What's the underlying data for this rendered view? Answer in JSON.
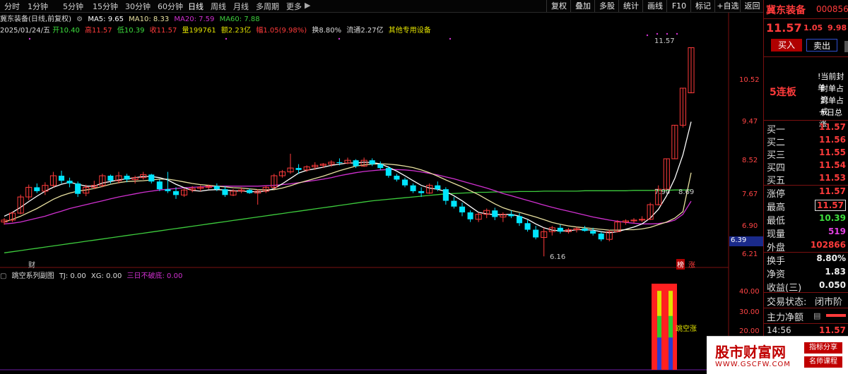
{
  "toolbar": {
    "periods": [
      "分时",
      "1分钟",
      "5分钟",
      "15分钟",
      "30分钟",
      "60分钟",
      "日线",
      "周线",
      "月线",
      "多周期",
      "更多"
    ],
    "active_period": "日线",
    "buttons": [
      "复权",
      "叠加",
      "多股",
      "统计",
      "画线",
      "F10",
      "标记",
      "+自选",
      "返回"
    ]
  },
  "info": {
    "stock_title": "冀东装备(日线,前复权)",
    "ma5": "MA5: 9.65",
    "ma10": "MA10: 8.33",
    "ma20": "MA20: 7.59",
    "ma60": "MA60: 7.88",
    "date": "2025/01/24/五",
    "open": "开10.40",
    "high": "高11.57",
    "low": "低10.39",
    "close": "收11.57",
    "volume": "量199761",
    "amount": "额2.23亿",
    "change": "幅1.05(9.98%)",
    "turnover": "换8.80%",
    "float": "流通2.27亿",
    "sector": "其他专用设备"
  },
  "price_axis": [
    "10.52",
    "9.47",
    "8.52",
    "7.67",
    "6.90",
    "6.21"
  ],
  "current_price_tag": "6.39",
  "annotations": {
    "high_label": "11.57",
    "low_label": "6.16",
    "ma_label": "7.90",
    "ma_label2": "8.69",
    "cai_marker": "财",
    "bang_marker": "榜",
    "zhang_marker": "涨"
  },
  "indicator": {
    "name": "跳空系列副图",
    "tj": "TJ: 0.00",
    "xg": "XG: 0.00",
    "rule": "三日不破底: 0.00",
    "axis": [
      "40.00",
      "30.00",
      "20.00"
    ],
    "tag": "跳空涨"
  },
  "quote": {
    "name": "冀东装备",
    "code": "000856",
    "price": "11.57",
    "change": "1.05",
    "pct": "9.98",
    "buy_label": "买入",
    "sell_label": "卖出",
    "limit_board": "5连板",
    "notes": [
      "!当前封单",
      "封单占流",
      "封单占成",
      "十日总涨"
    ],
    "book": [
      {
        "k": "买一",
        "v": "11.57"
      },
      {
        "k": "买二",
        "v": "11.56"
      },
      {
        "k": "买三",
        "v": "11.55"
      },
      {
        "k": "买四",
        "v": "11.54"
      },
      {
        "k": "买五",
        "v": "11.53"
      }
    ],
    "stats": [
      {
        "k": "涨停",
        "v": "11.57",
        "c": "#ff3b3b"
      },
      {
        "k": "最高",
        "v": "11.57",
        "c": "#ff3b3b"
      },
      {
        "k": "最低",
        "v": "10.39",
        "c": "#3dde3d"
      },
      {
        "k": "现量",
        "v": "519",
        "c": "#e040e0"
      },
      {
        "k": "外盘",
        "v": "102866",
        "c": "#ff3b3b"
      }
    ],
    "stats2": [
      {
        "k": "换手",
        "v": "8.80%",
        "c": "#eeeeee"
      },
      {
        "k": "净资",
        "v": "1.83",
        "c": "#eeeeee"
      },
      {
        "k": "收益(三)",
        "v": "0.050",
        "c": "#eeeeee"
      }
    ],
    "trade_status_label": "交易状态:",
    "trade_status": "闭市阶",
    "main_flow_label": "主力净额",
    "tick_time": "14:56",
    "tick_price": "11.57"
  },
  "watermark": {
    "site": "股市财富网",
    "url": "WWW.GSCFW.COM",
    "tag1": "指标分享",
    "tag2": "名师课程"
  },
  "colors": {
    "up": "#ff3b3b",
    "down": "#00e5ff",
    "ma5": "#ffffff",
    "ma10": "#e8e0a0",
    "ma20": "#d030d0",
    "ma60": "#3dcc3d"
  },
  "chart_data": {
    "type": "candlestick",
    "price_ylim": [
      6.0,
      11.8
    ],
    "candles": [
      [
        7.05,
        7.15,
        6.98,
        7.1
      ],
      [
        7.1,
        7.32,
        7.05,
        7.28
      ],
      [
        7.28,
        7.76,
        7.25,
        7.7
      ],
      [
        7.7,
        8.02,
        7.62,
        7.95
      ],
      [
        7.95,
        8.05,
        7.8,
        7.85
      ],
      [
        7.85,
        8.08,
        7.75,
        8.0
      ],
      [
        8.0,
        8.35,
        7.95,
        8.25
      ],
      [
        8.25,
        8.38,
        8.05,
        8.12
      ],
      [
        8.12,
        8.2,
        7.95,
        8.05
      ],
      [
        8.05,
        8.1,
        7.7,
        7.78
      ],
      [
        7.8,
        8.02,
        7.72,
        7.95
      ],
      [
        7.95,
        8.12,
        7.9,
        8.0
      ],
      [
        8.0,
        8.3,
        7.95,
        8.25
      ],
      [
        8.25,
        8.28,
        8.05,
        8.12
      ],
      [
        8.12,
        8.35,
        8.05,
        8.25
      ],
      [
        8.25,
        8.3,
        8.08,
        8.15
      ],
      [
        8.15,
        8.25,
        8.05,
        8.2
      ],
      [
        8.2,
        8.35,
        8.15,
        8.28
      ],
      [
        8.28,
        8.3,
        8.05,
        8.1
      ],
      [
        8.1,
        8.15,
        7.85,
        7.9
      ],
      [
        7.9,
        8.35,
        7.8,
        7.85
      ],
      [
        7.85,
        7.95,
        7.65,
        7.75
      ],
      [
        7.75,
        7.92,
        7.7,
        7.88
      ],
      [
        7.88,
        7.98,
        7.82,
        7.92
      ],
      [
        7.92,
        8.0,
        7.85,
        7.95
      ],
      [
        7.95,
        8.02,
        7.9,
        7.98
      ],
      [
        7.98,
        8.05,
        7.85,
        7.9
      ],
      [
        7.9,
        7.98,
        7.7,
        7.75
      ],
      [
        7.75,
        7.9,
        7.72,
        7.85
      ],
      [
        7.85,
        7.95,
        7.8,
        7.88
      ],
      [
        7.88,
        7.92,
        7.78,
        7.8
      ],
      [
        7.8,
        7.9,
        7.5,
        7.85
      ],
      [
        7.85,
        8.0,
        7.8,
        7.95
      ],
      [
        7.95,
        8.3,
        7.9,
        8.25
      ],
      [
        8.25,
        8.4,
        8.2,
        8.35
      ],
      [
        8.35,
        8.82,
        8.3,
        8.45
      ],
      [
        8.45,
        8.55,
        8.3,
        8.4
      ],
      [
        8.4,
        8.52,
        8.35,
        8.48
      ],
      [
        8.48,
        8.6,
        8.4,
        8.52
      ],
      [
        8.52,
        8.58,
        8.45,
        8.55
      ],
      [
        8.55,
        8.65,
        8.48,
        8.6
      ],
      [
        8.6,
        8.7,
        8.52,
        8.58
      ],
      [
        8.58,
        8.72,
        8.55,
        8.65
      ],
      [
        8.65,
        8.68,
        8.45,
        8.5
      ],
      [
        8.5,
        8.72,
        8.48,
        8.65
      ],
      [
        8.65,
        8.7,
        8.5,
        8.55
      ],
      [
        8.55,
        8.62,
        8.4,
        8.45
      ],
      [
        8.45,
        8.5,
        8.2,
        8.25
      ],
      [
        8.25,
        8.3,
        8.1,
        8.15
      ],
      [
        8.15,
        8.2,
        7.95,
        8.0
      ],
      [
        8.0,
        8.05,
        7.8,
        7.85
      ],
      [
        7.85,
        7.95,
        7.7,
        7.8
      ],
      [
        7.8,
        8.05,
        7.78,
        8.0
      ],
      [
        8.0,
        8.1,
        7.85,
        7.9
      ],
      [
        7.9,
        7.95,
        7.5,
        7.6
      ],
      [
        7.6,
        7.7,
        7.4,
        7.45
      ],
      [
        7.45,
        7.55,
        7.2,
        7.3
      ],
      [
        7.3,
        7.35,
        7.05,
        7.12
      ],
      [
        7.12,
        7.3,
        7.05,
        7.25
      ],
      [
        7.25,
        7.4,
        7.15,
        7.35
      ],
      [
        7.35,
        7.42,
        7.1,
        7.18
      ],
      [
        7.18,
        7.3,
        7.05,
        7.25
      ],
      [
        7.25,
        7.35,
        7.15,
        7.2
      ],
      [
        7.2,
        7.28,
        6.95,
        7.02
      ],
      [
        7.02,
        7.1,
        6.8,
        6.85
      ],
      [
        6.85,
        6.95,
        6.6,
        6.65
      ],
      [
        6.65,
        6.9,
        6.16,
        6.8
      ],
      [
        6.8,
        6.95,
        6.7,
        6.9
      ],
      [
        6.9,
        6.98,
        6.75,
        6.8
      ],
      [
        6.8,
        6.9,
        6.75,
        6.85
      ],
      [
        6.85,
        6.92,
        6.78,
        6.88
      ],
      [
        6.88,
        6.95,
        6.8,
        6.82
      ],
      [
        6.82,
        6.9,
        6.7,
        6.75
      ],
      [
        6.75,
        6.8,
        6.55,
        6.6
      ],
      [
        6.6,
        6.85,
        6.55,
        6.8
      ],
      [
        6.8,
        7.1,
        6.78,
        7.05
      ],
      [
        7.05,
        7.12,
        6.98,
        7.08
      ],
      [
        7.08,
        7.15,
        7.02,
        7.1
      ],
      [
        7.1,
        7.2,
        7.05,
        7.12
      ],
      [
        7.12,
        7.55,
        7.1,
        7.5
      ],
      [
        7.5,
        8.0,
        7.48,
        7.9
      ],
      [
        7.9,
        8.69,
        7.9,
        8.69
      ],
      [
        8.69,
        9.56,
        8.69,
        9.56
      ],
      [
        9.56,
        10.52,
        9.5,
        10.52
      ],
      [
        10.4,
        11.57,
        10.39,
        11.57
      ]
    ],
    "ma5": [
      7.2,
      7.3,
      7.43,
      7.58,
      7.72,
      7.85,
      7.95,
      8.03,
      8.08,
      8.03,
      7.98,
      7.98,
      8.06,
      8.1,
      8.14,
      8.17,
      8.2,
      8.23,
      8.23,
      8.2,
      8.14,
      8.03,
      7.94,
      7.87,
      7.85,
      7.88,
      7.89,
      7.88,
      7.86,
      7.85,
      7.84,
      7.83,
      7.85,
      7.92,
      8.04,
      8.18,
      8.32,
      8.39,
      8.43,
      8.47,
      8.52,
      8.55,
      8.58,
      8.58,
      8.6,
      8.59,
      8.56,
      8.47,
      8.37,
      8.25,
      8.12,
      8.0,
      7.93,
      7.9,
      7.84,
      7.73,
      7.6,
      7.45,
      7.3,
      7.26,
      7.24,
      7.24,
      7.25,
      7.2,
      7.12,
      7.0,
      6.9,
      6.84,
      6.82,
      6.82,
      6.85,
      6.85,
      6.84,
      6.8,
      6.77,
      6.8,
      6.86,
      6.92,
      7.0,
      7.15,
      7.38,
      7.73,
      8.18,
      8.79,
      9.65
    ],
    "ma10": [
      7.05,
      7.12,
      7.2,
      7.3,
      7.4,
      7.52,
      7.64,
      7.73,
      7.8,
      7.85,
      7.88,
      7.92,
      7.97,
      8.03,
      8.07,
      8.1,
      8.11,
      8.12,
      8.14,
      8.16,
      8.16,
      8.13,
      8.09,
      8.05,
      8.02,
      8.0,
      7.98,
      7.96,
      7.94,
      7.93,
      7.91,
      7.89,
      7.88,
      7.89,
      7.93,
      7.99,
      8.06,
      8.12,
      8.18,
      8.24,
      8.31,
      8.38,
      8.44,
      8.5,
      8.53,
      8.55,
      8.56,
      8.55,
      8.53,
      8.5,
      8.46,
      8.4,
      8.33,
      8.24,
      8.14,
      8.05,
      7.96,
      7.86,
      7.76,
      7.64,
      7.52,
      7.42,
      7.35,
      7.3,
      7.24,
      7.18,
      7.11,
      7.04,
      6.99,
      6.95,
      6.92,
      6.9,
      6.88,
      6.86,
      6.84,
      6.84,
      6.85,
      6.85,
      6.87,
      6.91,
      6.98,
      7.05,
      7.15,
      7.32,
      8.33
    ],
    "ma20": [
      7.0,
      7.02,
      7.05,
      7.1,
      7.15,
      7.2,
      7.27,
      7.33,
      7.4,
      7.45,
      7.5,
      7.55,
      7.6,
      7.65,
      7.7,
      7.74,
      7.78,
      7.82,
      7.85,
      7.88,
      7.9,
      7.92,
      7.94,
      7.95,
      7.96,
      7.97,
      7.98,
      7.98,
      7.98,
      7.98,
      7.98,
      7.98,
      7.99,
      8.0,
      8.02,
      8.04,
      8.07,
      8.1,
      8.13,
      8.16,
      8.2,
      8.25,
      8.29,
      8.33,
      8.36,
      8.38,
      8.4,
      8.41,
      8.41,
      8.4,
      8.38,
      8.35,
      8.31,
      8.27,
      8.22,
      8.17,
      8.11,
      8.05,
      7.99,
      7.93,
      7.86,
      7.79,
      7.73,
      7.67,
      7.61,
      7.55,
      7.49,
      7.43,
      7.38,
      7.33,
      7.28,
      7.23,
      7.18,
      7.14,
      7.1,
      7.07,
      7.04,
      7.02,
      7.0,
      7.0,
      7.01,
      7.04,
      7.1,
      7.25,
      7.59
    ],
    "ma60": [
      6.25,
      6.28,
      6.31,
      6.34,
      6.37,
      6.4,
      6.43,
      6.46,
      6.49,
      6.52,
      6.55,
      6.58,
      6.61,
      6.64,
      6.67,
      6.7,
      6.73,
      6.76,
      6.79,
      6.82,
      6.85,
      6.88,
      6.91,
      6.94,
      6.97,
      7.0,
      7.03,
      7.06,
      7.09,
      7.12,
      7.15,
      7.18,
      7.21,
      7.24,
      7.27,
      7.3,
      7.33,
      7.36,
      7.39,
      7.42,
      7.45,
      7.48,
      7.51,
      7.54,
      7.57,
      7.6,
      7.62,
      7.64,
      7.66,
      7.68,
      7.7,
      7.72,
      7.74,
      7.76,
      7.78,
      7.79,
      7.8,
      7.81,
      7.82,
      7.82,
      7.83,
      7.83,
      7.83,
      7.84,
      7.84,
      7.84,
      7.85,
      7.85,
      7.85,
      7.85,
      7.85,
      7.86,
      7.86,
      7.86,
      7.86,
      7.86,
      7.86,
      7.87,
      7.87,
      7.87,
      7.87,
      7.87,
      7.88,
      7.88,
      7.88
    ],
    "indicator_ylim": [
      0,
      48
    ],
    "indicator_bars": [
      {
        "red": 48,
        "yellow": 44,
        "green": 30,
        "blue": 18
      }
    ]
  }
}
